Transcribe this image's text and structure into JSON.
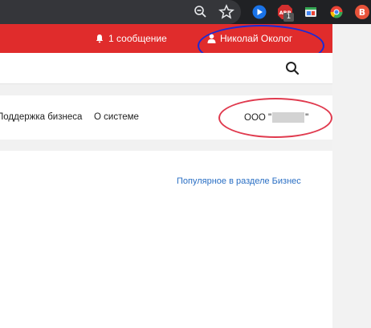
{
  "browser": {
    "icons": [
      "zoom-icon",
      "star-icon",
      "extension-video-icon",
      "abp-icon",
      "tab-manager-icon",
      "chrome-apps-icon",
      "profile-b-icon"
    ],
    "abp_badge": "1",
    "abp_label": "ABP",
    "profile_letter": "B"
  },
  "header": {
    "notifications": "1 сообщение",
    "user_name": "Николай Околог"
  },
  "nav": {
    "items": [
      "Поддержка бизнеса",
      "О системе"
    ],
    "company_prefix": "ООО \"",
    "company_suffix": "\""
  },
  "content": {
    "popular_link": "Популярное в разделе Бизнес"
  },
  "colors": {
    "brand_red": "#e02c2c",
    "link_blue": "#2a6fc4",
    "annotation_blue": "#1a2bd6",
    "annotation_red": "#e03a4e"
  }
}
